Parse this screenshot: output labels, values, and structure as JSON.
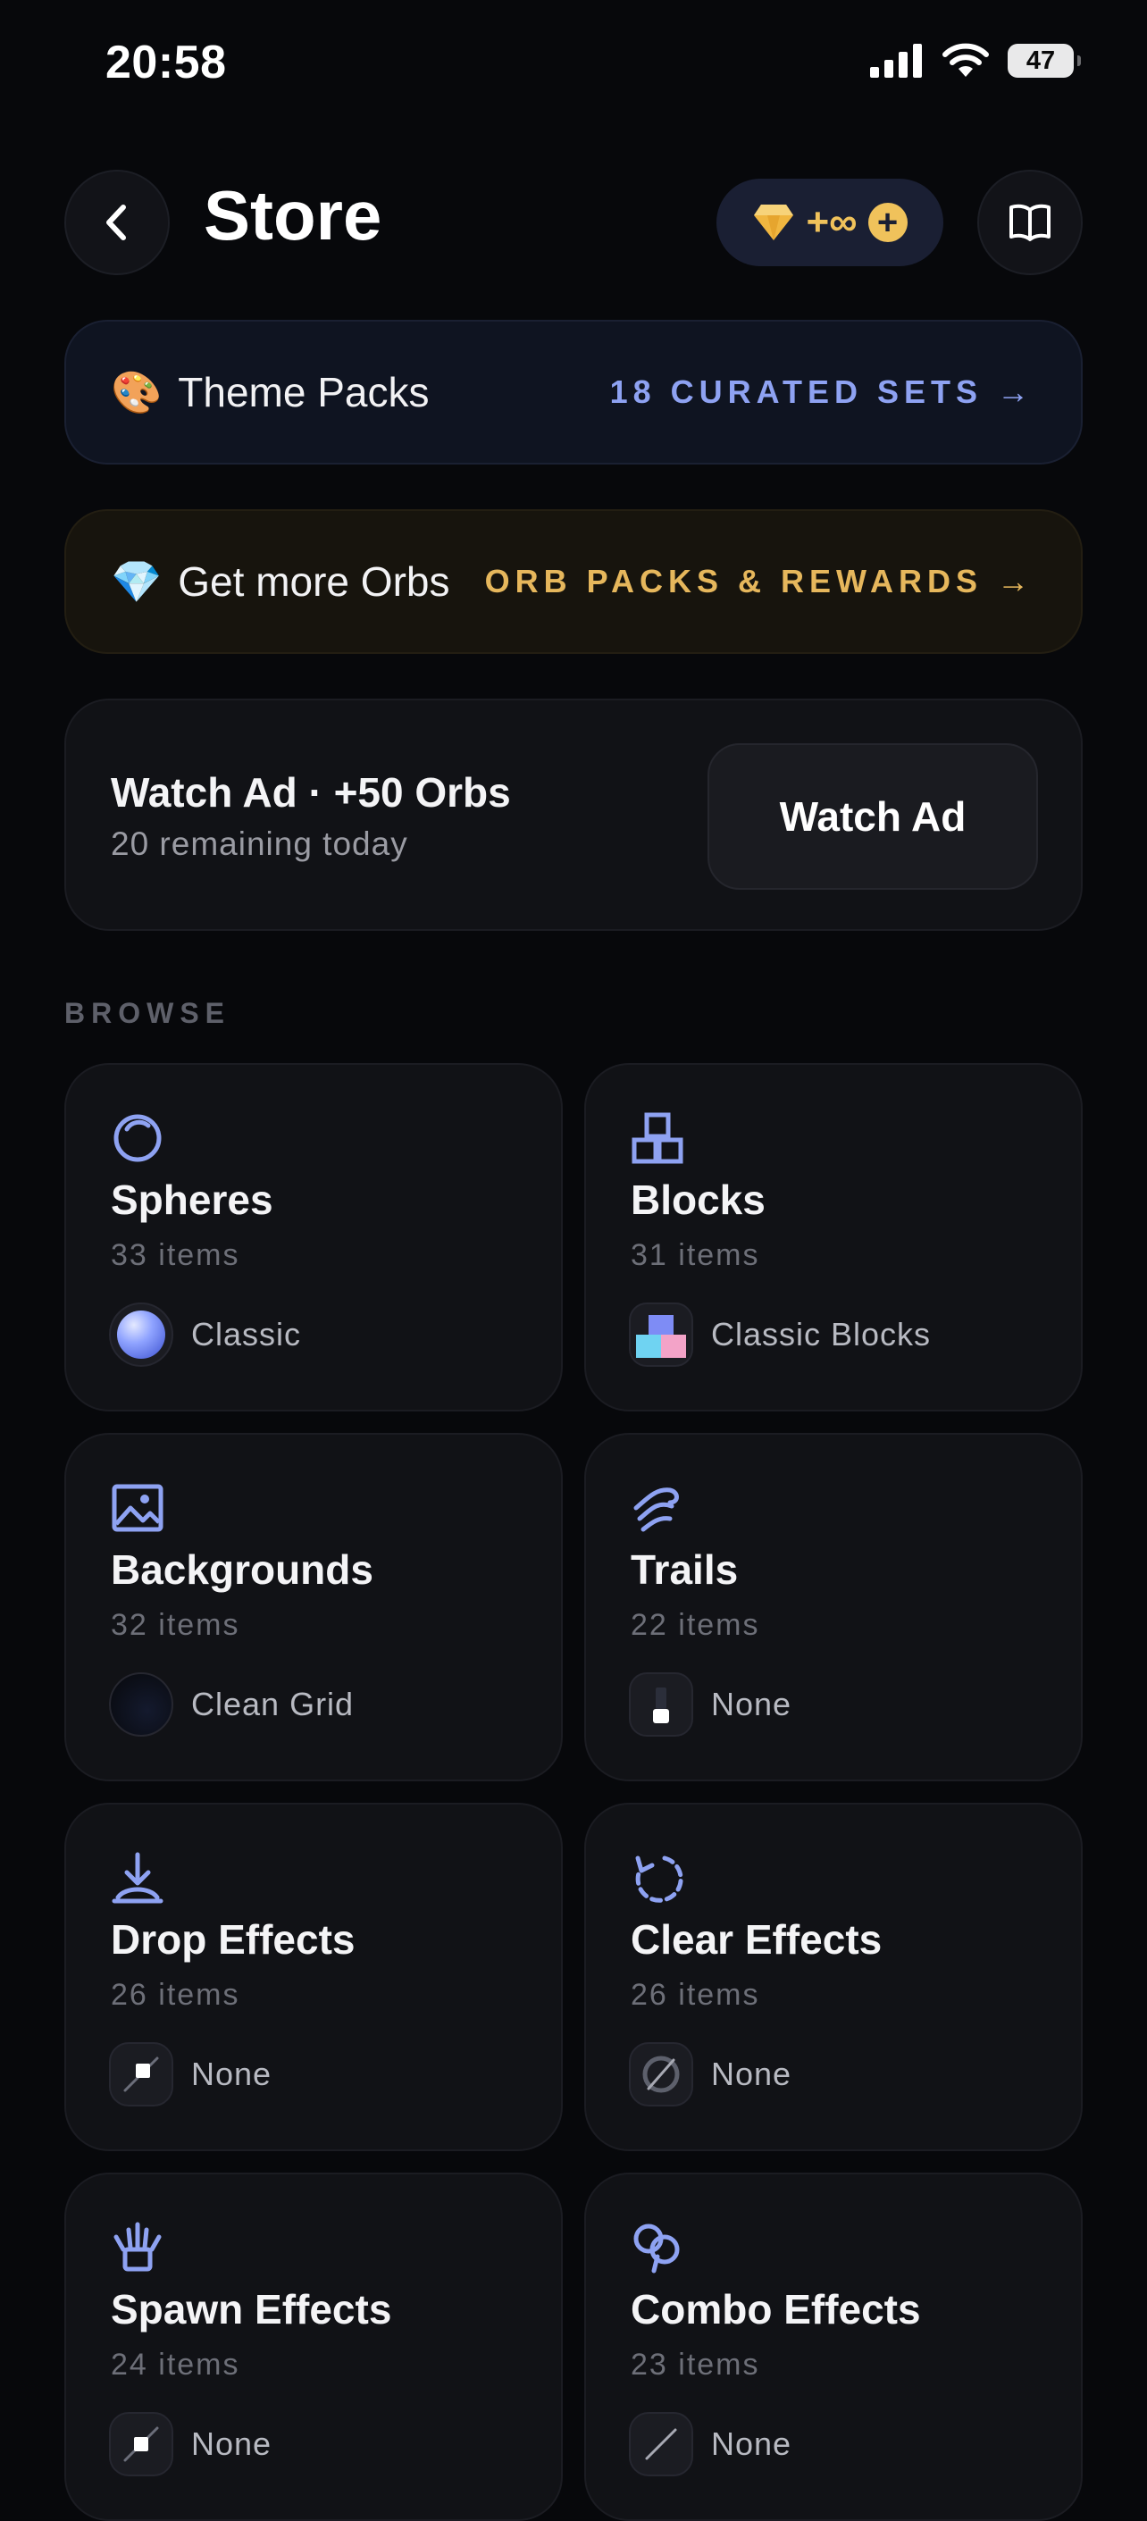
{
  "status_bar": {
    "time": "20:58",
    "battery": "47"
  },
  "header": {
    "title": "Store",
    "orbs": "+∞"
  },
  "banners": {
    "theme": {
      "emoji": "🎨",
      "label": "Theme Packs",
      "cta": "18 CURATED SETS →"
    },
    "orbs": {
      "emoji": "💎",
      "label": "Get more Orbs",
      "cta": "ORB PACKS & REWARDS →"
    }
  },
  "watch_ad": {
    "title": "Watch Ad · +50 Orbs",
    "subtitle": "20 remaining today",
    "button": "Watch Ad"
  },
  "browse": {
    "label": "BROWSE",
    "cards": [
      {
        "name": "Spheres",
        "count": "33 items",
        "selected": "Classic",
        "icon": "sphere-icon"
      },
      {
        "name": "Blocks",
        "count": "31 items",
        "selected": "Classic Blocks",
        "icon": "blocks-icon"
      },
      {
        "name": "Backgrounds",
        "count": "32 items",
        "selected": "Clean Grid",
        "icon": "image-icon"
      },
      {
        "name": "Trails",
        "count": "22 items",
        "selected": "None",
        "icon": "wind-icon"
      },
      {
        "name": "Drop Effects",
        "count": "26 items",
        "selected": "None",
        "icon": "drop-icon"
      },
      {
        "name": "Clear Effects",
        "count": "26 items",
        "selected": "None",
        "icon": "refresh-icon"
      },
      {
        "name": "Spawn Effects",
        "count": "24 items",
        "selected": "None",
        "icon": "hand-icon"
      },
      {
        "name": "Combo Effects",
        "count": "23 items",
        "selected": "None",
        "icon": "combo-icon"
      }
    ]
  },
  "colors": {
    "accent_blue": "#8ea2f2",
    "accent_gold": "#f0c25b",
    "background": "#07080b"
  }
}
